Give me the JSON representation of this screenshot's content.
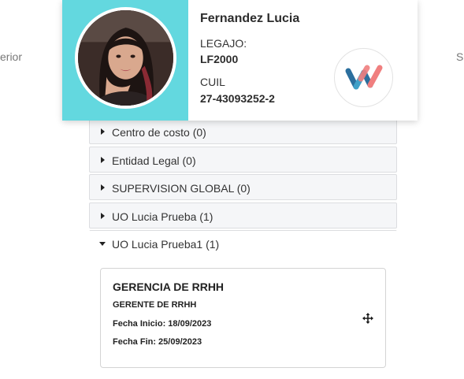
{
  "background_tabs": {
    "left_partial": "erior",
    "right_partial": "Si"
  },
  "employee": {
    "name": "Fernandez Lucia",
    "legajo_label": "LEGAJO:",
    "legajo_value": "LF2000",
    "cuil_label": "CUIL",
    "cuil_value": "27-43093252-2",
    "photo_background": "#63d8df",
    "logo_colors": [
      "#2b6f9e",
      "#f07f7f",
      "#3fa0c8"
    ]
  },
  "groups": [
    {
      "label": "Centro de costo (0)",
      "expanded": false
    },
    {
      "label": "Entidad Legal (0)",
      "expanded": false
    },
    {
      "label": "SUPERVISION GLOBAL (0)",
      "expanded": false
    },
    {
      "label": "UO Lucia Prueba (1)",
      "expanded": false
    },
    {
      "label": "UO Lucia Prueba1 (1)",
      "expanded": true
    }
  ],
  "position_card": {
    "title": "GERENCIA DE RRHH",
    "role": "GERENTE DE RRHH",
    "start": "Fecha Inicio: 18/09/2023",
    "end": "Fecha Fin: 25/09/2023",
    "action_icon": "move-icon"
  }
}
